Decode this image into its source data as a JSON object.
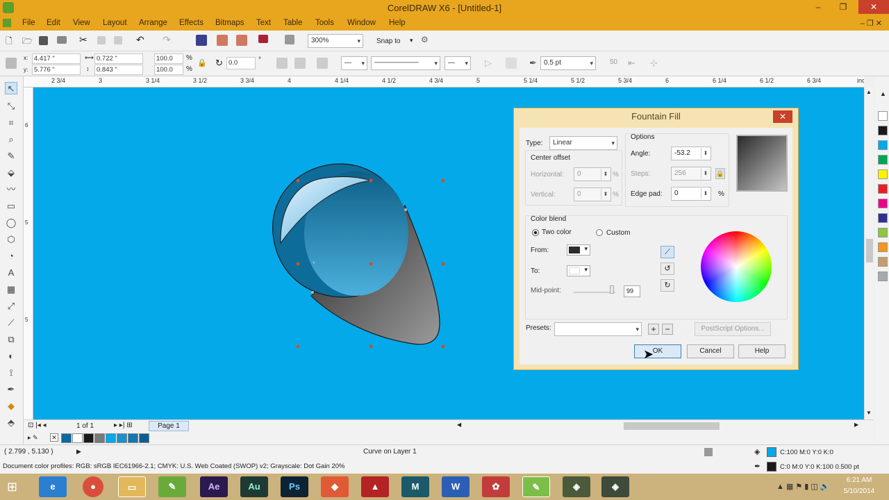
{
  "window": {
    "title": "CorelDRAW X6 - [Untitled-1]"
  },
  "menu": [
    "File",
    "Edit",
    "View",
    "Layout",
    "Arrange",
    "Effects",
    "Bitmaps",
    "Text",
    "Table",
    "Tools",
    "Window",
    "Help"
  ],
  "standard_toolbar": {
    "zoom": "300%",
    "snap_to": "Snap to"
  },
  "property_bar": {
    "x": "4.417 \"",
    "y": "5.776 \"",
    "width": "0.722 \"",
    "height": "0.843 \"",
    "scale_w": "100.0",
    "scale_h": "100.0",
    "percent": "%",
    "rotation": "0.0",
    "degree": "°",
    "outline_width": "0.5 pt",
    "nib": "50"
  },
  "ruler": {
    "h_labels": [
      "2 3/4",
      "3",
      "3 1/4",
      "3 1/2",
      "3 3/4",
      "4",
      "4 1/4",
      "4 1/2",
      "4 3/4",
      "5",
      "5 1/4",
      "5 1/2",
      "5 3/4",
      "6",
      "6 1/4",
      "6 1/2",
      "6 3/4"
    ],
    "units": "inches"
  },
  "page_nav": {
    "position": "1 of 1",
    "page_tab": "Page 1"
  },
  "status": {
    "coords": "( 2.799 , 5.130 )",
    "object": "Curve on Layer 1",
    "profile": "Document color profiles: RGB: sRGB IEC61966-2.1; CMYK: U.S. Web Coated (SWOP) v2; Grayscale: Dot Gain 20%",
    "fill_info": "C:100 M:0 Y:0 K:0",
    "outline_info": "C:0 M:0 Y:0 K:100  0.500 pt",
    "fill_color": "#03a9e9",
    "outline_color": "#1a1a1a"
  },
  "dialog": {
    "title": "Fountain Fill",
    "type_label": "Type:",
    "type_value": "Linear",
    "center_offset": "Center offset",
    "horizontal": "Horizontal:",
    "vertical": "Vertical:",
    "h_value": "0",
    "v_value": "0",
    "options": "Options",
    "angle_label": "Angle:",
    "angle_value": "-53.2",
    "steps_label": "Steps:",
    "steps_value": "256",
    "edge_pad_label": "Edge pad:",
    "edge_pad_value": "0",
    "percent": "%",
    "color_blend": "Color blend",
    "two_color": "Two color",
    "custom": "Custom",
    "from": "From:",
    "to": "To:",
    "midpoint": "Mid-point:",
    "midpoint_value": "99",
    "presets": "Presets:",
    "postscript": "PostScript Options...",
    "ok": "OK",
    "cancel": "Cancel",
    "help": "Help",
    "from_color": "#2b2b2b",
    "to_color": "#ffffff"
  },
  "palette_colors": [
    "#ffffff",
    "#1a1a1a",
    "#03a9e9",
    "#00a651",
    "#fff200",
    "#ed1c24",
    "#ec008c",
    "#2e3192",
    "#8dc63f",
    "#f7941d",
    "#c69c6d",
    "#a7a9ac"
  ],
  "doc_palette": [
    "#0a6aa0",
    "#ffffff",
    "#1a1a1a",
    "#7a7a7a",
    "#03a9e9",
    "#1f8fc7",
    "#1477b0",
    "#0d5d8e"
  ],
  "taskbar": {
    "time": "6:21 AM",
    "date": "5/10/2014",
    "ae": "Ae",
    "au": "Au",
    "ps": "Ps"
  }
}
